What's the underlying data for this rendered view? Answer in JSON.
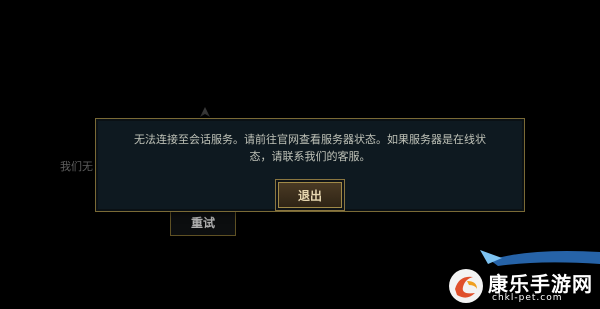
{
  "background": {
    "partial_text": "我们无",
    "retry_button_label": "重试"
  },
  "dialog": {
    "message_line1": "无法连接至会话服务。请前往官网查看服务器状态。如果服务器是在线状",
    "message_line2": "态，请联系我们的客服。",
    "exit_button_label": "退出"
  },
  "watermark": {
    "brand_name": "康乐手游网",
    "domain": "chkl-pet.com"
  },
  "colors": {
    "dialog_bg": "#0e1920",
    "gold_border": "#7a6a36",
    "exit_button_bg": "#3c2f1e",
    "text": "#bfc2b8",
    "watermark_accent": "#2d74c6"
  },
  "icons": {
    "background_emblem": "emblem-icon",
    "watermark_logo": "swirl-logo-icon"
  }
}
